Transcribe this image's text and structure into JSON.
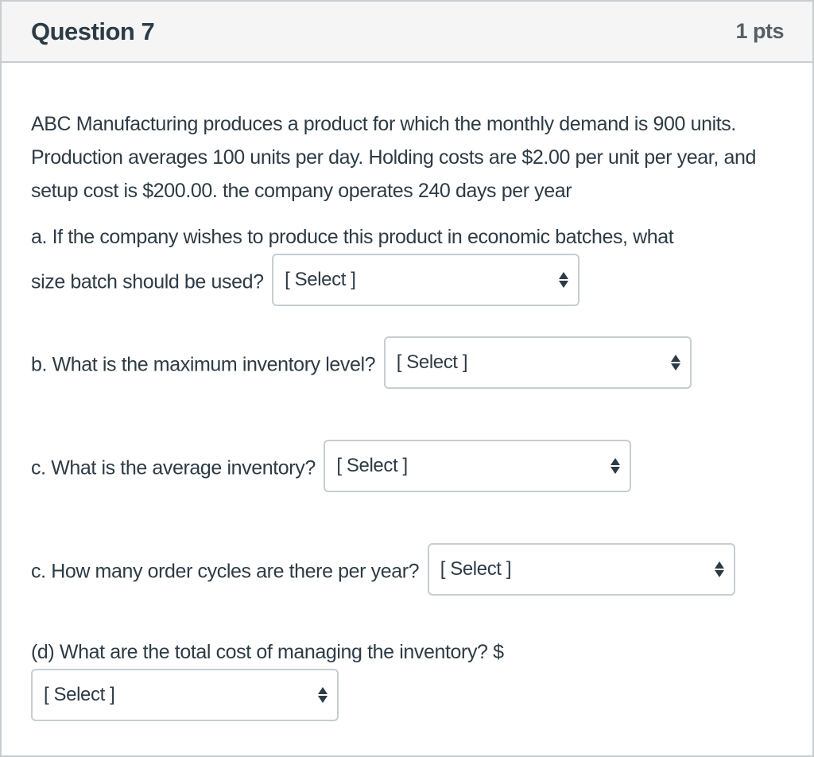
{
  "question": {
    "title": "Question 7",
    "points": "1 pts",
    "intro": "ABC Manufacturing produces a product for which the monthly demand is 900 units. Production averages 100 units per day. Holding costs are $2.00 per unit per year, and setup cost is $200.00. the company operates 240 days per year",
    "parts": [
      {
        "text_line1": "a. If the company wishes to produce this product in economic batches, what",
        "text_line2": "size batch should be used?",
        "select_value": "[ Select ]"
      },
      {
        "text": "b. What is the maximum inventory level?",
        "select_value": "[ Select ]"
      },
      {
        "text": "c. What is the average inventory?",
        "select_value": "[ Select ]"
      },
      {
        "text": "c. How many order cycles are there per year?",
        "select_value": "[ Select ]"
      },
      {
        "text": "(d) What are the total cost of managing the inventory? $",
        "select_value": "[ Select ]"
      }
    ]
  }
}
